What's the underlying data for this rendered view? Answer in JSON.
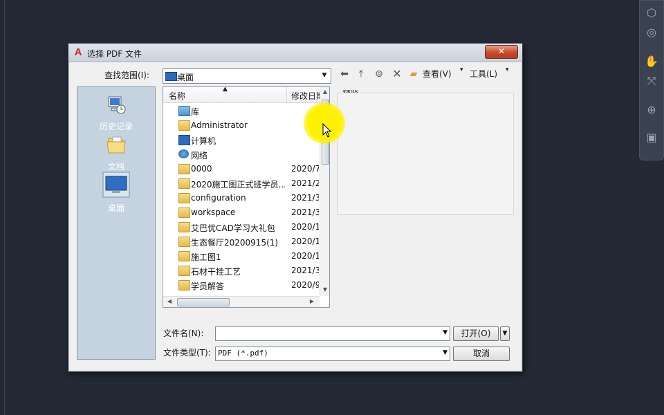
{
  "dialog": {
    "title": "选择 PDF 文件",
    "close_label": "✕"
  },
  "look_in": {
    "label": "查找范围(I):",
    "value": "桌面"
  },
  "toolbar": {
    "view_label": "查看(V)",
    "tools_label": "工具(L)"
  },
  "places": [
    {
      "label": "历史记录"
    },
    {
      "label": "文档"
    },
    {
      "label": "桌面"
    }
  ],
  "list": {
    "col_name": "名称",
    "col_modified": "修改日期",
    "rows": [
      {
        "name": "库",
        "date": ""
      },
      {
        "name": "Administrator",
        "date": ""
      },
      {
        "name": "计算机",
        "date": ""
      },
      {
        "name": "网络",
        "date": ""
      },
      {
        "name": "0000",
        "date": "2020/7"
      },
      {
        "name": "2020施工图正式班学员...",
        "date": "2021/2"
      },
      {
        "name": "configuration",
        "date": "2021/3"
      },
      {
        "name": "workspace",
        "date": "2021/3"
      },
      {
        "name": "艾巴优CAD学习大礼包",
        "date": "2020/1"
      },
      {
        "name": "生态餐厅20200915(1)",
        "date": "2020/1"
      },
      {
        "name": "施工图1",
        "date": "2020/1"
      },
      {
        "name": "石材干挂工艺",
        "date": "2021/3"
      },
      {
        "name": "学员解答",
        "date": "2020/9"
      }
    ]
  },
  "preview": {
    "label": "预览"
  },
  "file_name": {
    "label": "文件名(N):",
    "value": "",
    "open_label": "打开(O)"
  },
  "file_type": {
    "label": "文件类型(T):",
    "value": "PDF (*.pdf)",
    "cancel_label": "取消"
  },
  "colors": {
    "accent": "#fff200",
    "places_bg": "#c5d3e0",
    "background": "#232a36"
  }
}
